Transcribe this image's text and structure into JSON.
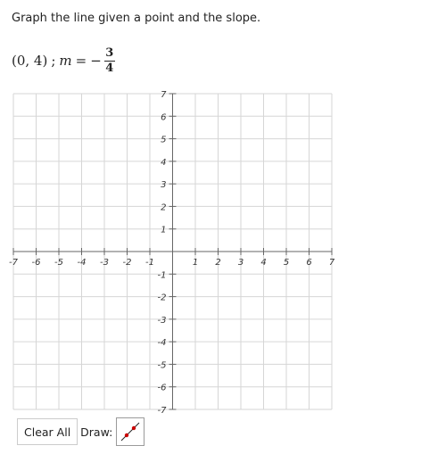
{
  "problem": {
    "instruction": "Graph the line given a point and the slope.",
    "point": "(0, 4)",
    "separator": ";",
    "variable": "m",
    "equals": "=",
    "sign": "−",
    "numerator": "3",
    "denominator": "4"
  },
  "graph": {
    "x_min": -7,
    "x_max": 7,
    "y_min": -7,
    "y_max": 7,
    "x_tick_labels": [
      "-7",
      "-6",
      "-5",
      "-4",
      "-3",
      "-2",
      "-1",
      "1",
      "2",
      "3",
      "4",
      "5",
      "6",
      "7"
    ],
    "y_tick_labels": [
      "7",
      "6",
      "5",
      "4",
      "3",
      "2",
      "1",
      "-1",
      "-2",
      "-3",
      "-4",
      "-5",
      "-6",
      "-7"
    ],
    "grid": true
  },
  "toolbar": {
    "clear_label": "Clear All",
    "draw_label": "Draw:",
    "line_tool_icon": "line-tool-icon",
    "line_tool_color": "#cc0000"
  }
}
